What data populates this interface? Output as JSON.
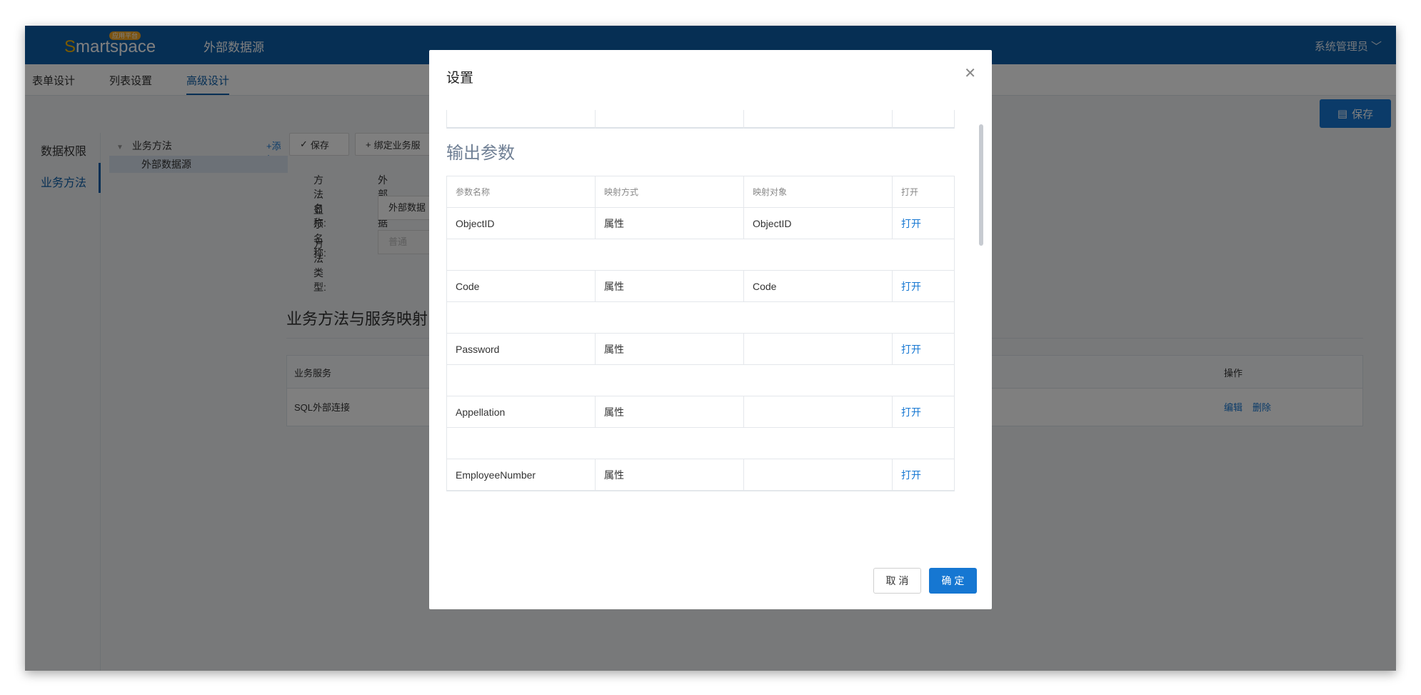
{
  "header": {
    "logo_prefix": "S",
    "logo_rest": "martspace",
    "logo_badge": "应用平台",
    "title": "外部数据源",
    "user": "系统管理员 ﹀"
  },
  "tabs": [
    {
      "label": "表单设计"
    },
    {
      "label": "列表设置"
    },
    {
      "label": "高级设计"
    }
  ],
  "save_button": "保存",
  "left_nav": [
    {
      "label": "数据权限"
    },
    {
      "label": "业务方法"
    }
  ],
  "tree": {
    "root": "业务方法",
    "add": "+添加",
    "child": "外部数据源"
  },
  "form": {
    "save_btn": "保存",
    "bind_btn": "绑定业务服",
    "method_name_label": "方法名称:",
    "method_name_value": "外部数据源",
    "display_name_label": "显示名称:",
    "display_name_value": "外部数据",
    "method_type_label": "方法类型:",
    "method_type_value": "普通"
  },
  "mapping": {
    "title": "业务方法与服务映射",
    "col_service": "业务服务",
    "col_action": "操作",
    "row_service": "SQL外部连接",
    "row_edit": "编辑",
    "row_delete": "删除"
  },
  "modal": {
    "title": "设置",
    "section_title": "输出参数",
    "headers": [
      "参数名称",
      "映射方式",
      "映射对象",
      "打开"
    ],
    "rows": [
      {
        "name": "ObjectID",
        "mode": "属性",
        "target": "ObjectID",
        "open": "打开"
      },
      {
        "name": "Code",
        "mode": "属性",
        "target": "Code",
        "open": "打开"
      },
      {
        "name": "Password",
        "mode": "属性",
        "target": "",
        "open": "打开"
      },
      {
        "name": "Appellation",
        "mode": "属性",
        "target": "",
        "open": "打开"
      },
      {
        "name": "EmployeeNumber",
        "mode": "属性",
        "target": "",
        "open": "打开"
      }
    ],
    "cancel": "取 消",
    "ok": "确 定"
  }
}
